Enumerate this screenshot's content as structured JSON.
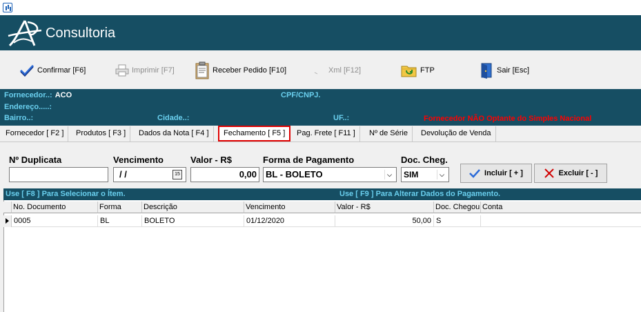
{
  "window": {
    "icon": "chart-icon"
  },
  "brand": {
    "name": "Consultoria"
  },
  "toolbar": {
    "confirmar": "Confirmar [F6]",
    "imprimir": "Imprimir  [F7]",
    "receber": "Receber Pedido [F10]",
    "xml": "Xml [F12]",
    "ftp": "FTP",
    "sair": "Sair [Esc]"
  },
  "info": {
    "fornecedor_label": "Fornecedor..:",
    "fornecedor_value": "ACO",
    "cpf_label": "CPF/CNPJ.",
    "endereco_label": "Endereço.....:",
    "bairro_label": "Bairro..:",
    "cidade_label": "Cidade..:",
    "uf_label": "UF..:",
    "simples_status": "Fornecedor NÃO Optante do Simples Nacional"
  },
  "tabs": [
    "Fornecedor [ F2 ]",
    "Produtos [ F3 ]",
    "Dados da Nota [ F4 ]",
    "Fechamento [ F5 ]",
    "Pag. Frete [ F11 ]",
    "Nº de Série",
    "Devolução de Venda"
  ],
  "form": {
    "duplicata_label": "Nº Duplicata",
    "duplicata_value": "",
    "vencimento_label": "Vencimento",
    "vencimento_value": " /  /",
    "calendar_text": "15",
    "valor_label": "Valor - R$",
    "valor_value": "0,00",
    "forma_label": "Forma de Pagamento",
    "forma_value": "BL - BOLETO",
    "doc_label": "Doc. Cheg.",
    "doc_value": "SIM",
    "incluir": "Incluir [ + ]",
    "excluir": "Excluir [ - ]"
  },
  "gridbar": {
    "left": "Use [ F8 ] Para Selecionar o Ítem.",
    "right": "Use [ F9 ] Para Alterar Dados do Pagamento."
  },
  "grid": {
    "columns": [
      "No. Documento",
      "Forma",
      "Descrição",
      "Vencimento",
      "Valor - R$",
      "Doc. Chegou",
      "Conta"
    ],
    "rows": [
      [
        "0005",
        "BL",
        "BOLETO",
        "01/12/2020",
        "50,00",
        "S",
        ""
      ]
    ]
  },
  "colors": {
    "banner": "#164e63",
    "label": "#6ad0ef",
    "alert": "#ff0000",
    "highlight": "#e00000"
  }
}
